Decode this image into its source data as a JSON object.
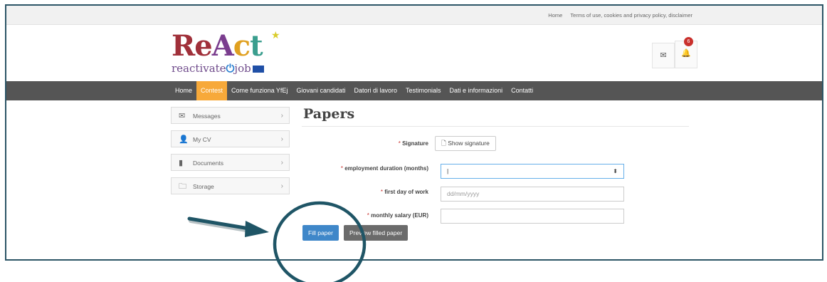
{
  "topbar": {
    "home": "Home",
    "terms": "Terms of use, cookies and privacy policy, disclaimer"
  },
  "logo": {
    "re1": "Re",
    "re2": "A",
    "re3": "c",
    "re4": "t",
    "sub_a": "reactivate",
    "sub_b": "job"
  },
  "header": {
    "notification_count": "6"
  },
  "nav": {
    "items": [
      "Home",
      "Contest",
      "Come funziona YfEj",
      "Giovani candidati",
      "Datori di lavoro",
      "Testimonials",
      "Dati e informazioni",
      "Contatti"
    ],
    "active_index": 1
  },
  "sidebar": {
    "items": [
      {
        "label": "Messages",
        "icon": "envelope-icon"
      },
      {
        "label": "My CV",
        "icon": "user-icon"
      },
      {
        "label": "Documents",
        "icon": "document-icon"
      },
      {
        "label": "Storage",
        "icon": "folder-icon"
      }
    ]
  },
  "page": {
    "title": "Papers"
  },
  "form": {
    "signature_label": "Signature",
    "signature_button": "Show signature",
    "duration_label": "employment duration (months)",
    "duration_value": "|",
    "first_day_label": "first day of work",
    "first_day_placeholder": "dd/mm/yyyy",
    "salary_label": "monthly salary (EUR)",
    "salary_value": "",
    "required_mark": "*"
  },
  "actions": {
    "fill": "Fill paper",
    "preview": "Preview filled paper"
  },
  "colors": {
    "nav_bg": "#555555",
    "nav_active": "#f7a93a",
    "primary": "#3f87c9",
    "annotation": "#1f5566"
  }
}
